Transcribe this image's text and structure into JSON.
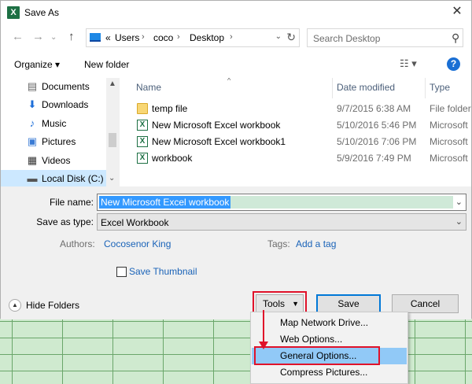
{
  "window": {
    "title": "Save As",
    "app_icon": "excel-icon",
    "close_label": "✕"
  },
  "nav": {
    "back_icon": "arrow-left-icon",
    "forward_icon": "arrow-right-icon",
    "up_icon": "arrow-up-icon",
    "address_prefix": "«",
    "breadcrumbs": [
      "Users",
      "coco",
      "Desktop"
    ],
    "search_placeholder": "Search Desktop"
  },
  "toolbar": {
    "organize": "Organize ▾",
    "new_folder": "New folder",
    "help": "?"
  },
  "sidebar": {
    "items": [
      {
        "label": "Documents",
        "icon": "documents-icon"
      },
      {
        "label": "Downloads",
        "icon": "downloads-icon"
      },
      {
        "label": "Music",
        "icon": "music-icon"
      },
      {
        "label": "Pictures",
        "icon": "pictures-icon"
      },
      {
        "label": "Videos",
        "icon": "videos-icon"
      },
      {
        "label": "Local Disk (C:)",
        "icon": "disk-icon",
        "selected": true
      }
    ]
  },
  "filelist": {
    "columns": [
      "Name",
      "Date modified",
      "Type"
    ],
    "rows": [
      {
        "name": "temp file",
        "date": "9/7/2015 6:38 AM",
        "type": "File folder",
        "icon": "folder-icon"
      },
      {
        "name": "New Microsoft Excel workbook",
        "date": "5/10/2016 5:46 PM",
        "type": "Microsoft",
        "icon": "excel-file-icon"
      },
      {
        "name": "New Microsoft Excel workbook1",
        "date": "5/10/2016 7:06 PM",
        "type": "Microsoft",
        "icon": "excel-file-icon"
      },
      {
        "name": "workbook",
        "date": "5/9/2016 7:49 PM",
        "type": "Microsoft",
        "icon": "excel-file-icon"
      }
    ]
  },
  "form": {
    "file_name_label": "File name:",
    "file_name_value": "New Microsoft Excel workbook",
    "save_type_label": "Save as type:",
    "save_type_value": "Excel Workbook",
    "authors_label": "Authors:",
    "authors_value": "Cocosenor King",
    "tags_label": "Tags:",
    "tags_value": "Add a tag",
    "thumbnail_label": "Save Thumbnail",
    "thumbnail_checked": false
  },
  "footer": {
    "hide_folders": "Hide Folders",
    "tools": "Tools",
    "save": "Save",
    "cancel": "Cancel"
  },
  "tools_menu": {
    "items": [
      "Map Network Drive...",
      "Web Options...",
      "General Options...",
      "Compress Pictures..."
    ],
    "highlighted_index": 2
  },
  "colors": {
    "highlight_red": "#e0122a",
    "selection_blue": "#3399ff",
    "link_blue": "#1a63b8"
  }
}
